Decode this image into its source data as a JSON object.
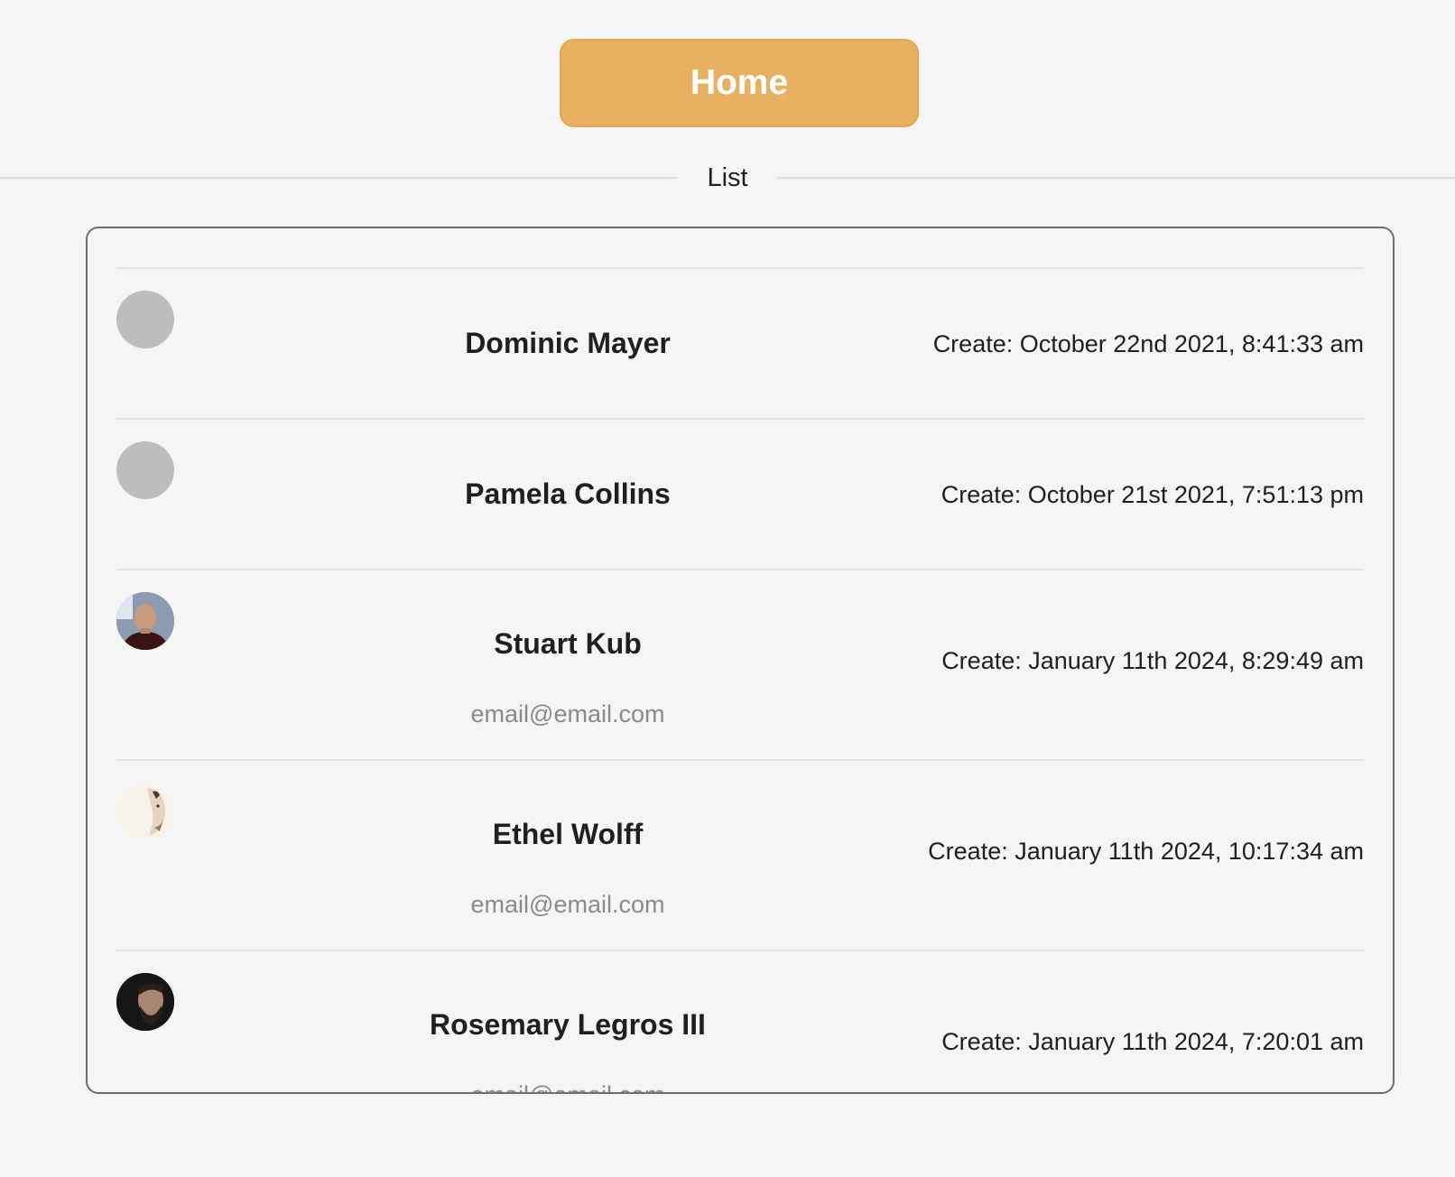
{
  "header": {
    "home_label": "Home"
  },
  "divider": {
    "label": "List"
  },
  "list": {
    "items": [
      {
        "name": "Dominic Mayer",
        "created": "Create: October 22nd 2021, 8:41:33 am",
        "avatar": "placeholder"
      },
      {
        "name": "Pamela Collins",
        "created": "Create: October 21st 2021, 7:51:13 pm",
        "avatar": "placeholder"
      },
      {
        "name": "Stuart Kub",
        "email": "email@email.com",
        "created": "Create: January 11th 2024, 8:29:49 am",
        "avatar": "photo"
      },
      {
        "name": "Ethel Wolff",
        "email": "email@email.com",
        "created": "Create: January 11th 2024, 10:17:34 am",
        "avatar": "photo"
      },
      {
        "name": "Rosemary Legros III",
        "email": "email@email.com",
        "created": "Create: January 11th 2024, 7:20:01 am",
        "avatar": "photo"
      }
    ]
  },
  "colors": {
    "accent": "#e8b161",
    "background": "#f5f5f5",
    "placeholder_avatar": "#bdbdbd"
  }
}
